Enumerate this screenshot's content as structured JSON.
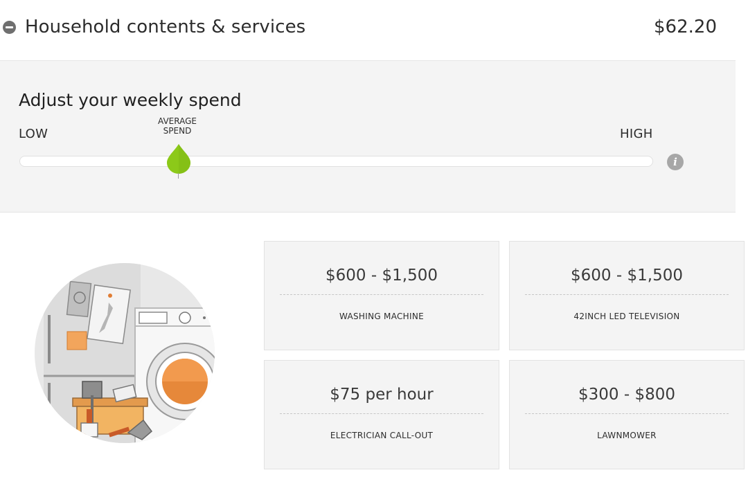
{
  "header": {
    "title": "Household contents & services",
    "total": "$62.20"
  },
  "adjust": {
    "title": "Adjust your weekly spend",
    "low_label": "LOW",
    "high_label": "HIGH",
    "average_label_line1": "AVERAGE",
    "average_label_line2": "SPEND",
    "slider_level": 0.25,
    "handle_color": "#8cc919"
  },
  "cards": [
    {
      "price": "$600 - $1,500",
      "label": "WASHING MACHINE"
    },
    {
      "price": "$600 - $1,500",
      "label": "42INCH LED TELEVISION"
    },
    {
      "price": "$75 per hour",
      "label": "ELECTRICIAN CALL-OUT"
    },
    {
      "price": "$300 - $800",
      "label": "LAWNMOWER"
    }
  ],
  "icons": {
    "collapse": "minus-circle-icon",
    "info": "info-icon",
    "illustration": "household-appliances-illustration"
  }
}
